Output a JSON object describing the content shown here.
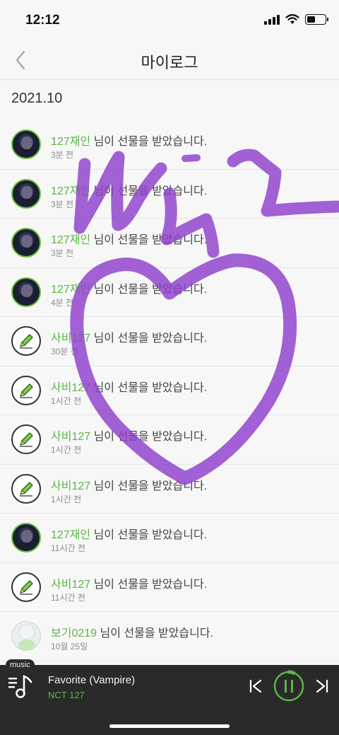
{
  "status_bar": {
    "time": "12:12",
    "battery_level": 0.45
  },
  "header": {
    "title": "마이로그",
    "back_icon": "chevron-left-icon"
  },
  "section_date": "2021.10",
  "log_suffix": " 님이 선물을 받았습니다.",
  "logs": [
    {
      "name": "127재인",
      "time": "3분 전",
      "avatar": "photo"
    },
    {
      "name": "127재인",
      "time": "3분 전",
      "avatar": "photo"
    },
    {
      "name": "127재인",
      "time": "3분 전",
      "avatar": "photo"
    },
    {
      "name": "127재인",
      "time": "4분 전",
      "avatar": "photo"
    },
    {
      "name": "사비127",
      "time": "30분 전",
      "avatar": "pencil-icon"
    },
    {
      "name": "사비127",
      "time": "1시간 전",
      "avatar": "pencil-icon"
    },
    {
      "name": "사비127",
      "time": "1시간 전",
      "avatar": "pencil-icon"
    },
    {
      "name": "사비127",
      "time": "1시간 전",
      "avatar": "pencil-icon"
    },
    {
      "name": "127재인",
      "time": "11시간 전",
      "avatar": "photo"
    },
    {
      "name": "사비127",
      "time": "11시간 전",
      "avatar": "pencil-icon"
    },
    {
      "name": "보기0219",
      "time": "10월 25일",
      "avatar": "photo-light"
    }
  ],
  "player": {
    "badge": "music",
    "song_title": "Favorite (Vampire)",
    "artist": "NCT 127",
    "accent": "#5cb548"
  },
  "colors": {
    "accent_green": "#5cb548",
    "drawing_purple": "#8e3fcc"
  }
}
